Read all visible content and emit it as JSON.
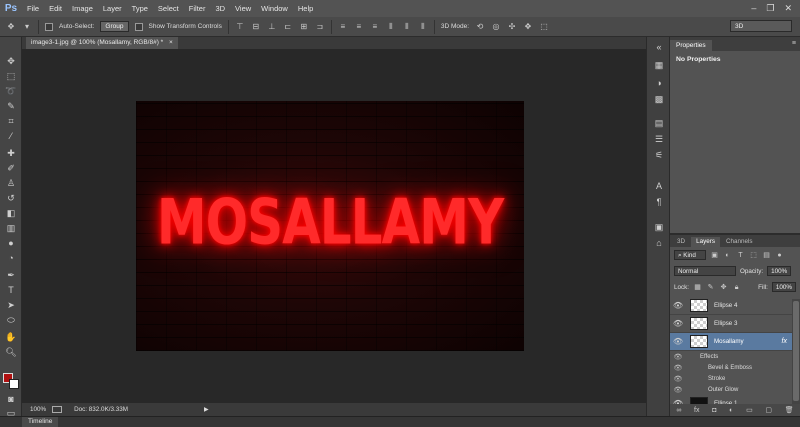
{
  "app": {
    "logo": "Ps"
  },
  "menu": [
    "File",
    "Edit",
    "Image",
    "Layer",
    "Type",
    "Select",
    "Filter",
    "3D",
    "View",
    "Window",
    "Help"
  ],
  "options": {
    "auto_select_label": "Auto-Select:",
    "auto_select_value": "Group",
    "show_transform_label": "Show Transform Controls",
    "mode_3d_label": "3D Mode:",
    "workspace": "3D"
  },
  "document": {
    "tab_title": "image3-1.jpg @ 100% (Mosallamy, RGB/8#) *",
    "tab_close": "×",
    "canvas_text": "MOSALLAMY"
  },
  "status": {
    "zoom": "100%",
    "doc_info": "Doc: 832.0K/3.33M"
  },
  "timeline": {
    "label": "Timeline"
  },
  "properties": {
    "tab": "Properties",
    "title": "No Properties"
  },
  "layers_panel": {
    "tabs": [
      "3D",
      "Layers",
      "Channels"
    ],
    "kind_label": "Kind",
    "blend_mode": "Normal",
    "opacity_label": "Opacity:",
    "opacity_value": "100%",
    "lock_label": "Lock:",
    "fill_label": "Fill:",
    "fill_value": "100%",
    "layers": [
      {
        "name": "Ellipse 4"
      },
      {
        "name": "Ellipse 3"
      },
      {
        "name": "Mosallamy",
        "fx": "fx"
      },
      {
        "name": "Ellipse 1"
      }
    ],
    "effects_label": "Effects",
    "effects": [
      "Bevel & Emboss",
      "Stroke",
      "Outer Glow"
    ]
  },
  "colors": {
    "foreground": "#b01010",
    "background": "#ffffff",
    "neon": "#ff2a2a",
    "selected_layer": "#5a7aa0"
  }
}
